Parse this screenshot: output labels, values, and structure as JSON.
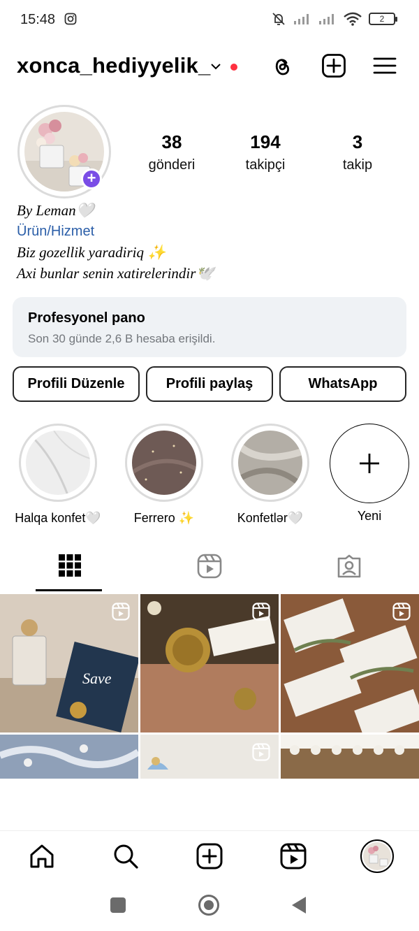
{
  "status_bar": {
    "time": "15:48",
    "battery": "2",
    "icons": [
      "instagram-icon",
      "mute-icon",
      "signal-icon",
      "signal-icon",
      "wifi-icon",
      "battery-icon"
    ]
  },
  "header": {
    "username": "xonca_hediyyelik_",
    "icons": [
      "chevron-down-icon",
      "threads-icon",
      "create-post-icon",
      "menu-icon"
    ],
    "notification_dot_color": "#ff3040"
  },
  "profile": {
    "stats": [
      {
        "value": "38",
        "label": "gönderi"
      },
      {
        "value": "194",
        "label": "takipçi"
      },
      {
        "value": "3",
        "label": "takip"
      }
    ],
    "bio": {
      "name_line": "By Leman🤍",
      "category": "Ürün/Hizmet",
      "line1": "Biz gozellik yaradiriq ✨",
      "line2": "Axi bunlar senin xatirelerindir🕊️"
    }
  },
  "pro_dashboard": {
    "title": "Profesyonel pano",
    "subtitle": "Son 30 günde 2,6 B hesaba erişildi."
  },
  "buttons": {
    "edit": "Profili Düzenle",
    "share": "Profili paylaş",
    "whatsapp": "WhatsApp"
  },
  "highlights": [
    {
      "label": "Halqa konfet🤍"
    },
    {
      "label": "Ferrero ✨"
    },
    {
      "label": "Konfetlər🤍"
    },
    {
      "label": "Yeni"
    }
  ],
  "tabs": [
    "grid-icon",
    "reels-icon",
    "tagged-icon"
  ],
  "bottom_nav": [
    "home-icon",
    "search-icon",
    "create-icon",
    "reels-icon",
    "profile-avatar"
  ],
  "system_nav": [
    "recents-square-icon",
    "home-circle-icon",
    "back-triangle-icon"
  ],
  "colors": {
    "accent_purple": "#7a4de6",
    "link_blue": "#2b5ea8",
    "panel_bg": "#eff2f5"
  }
}
